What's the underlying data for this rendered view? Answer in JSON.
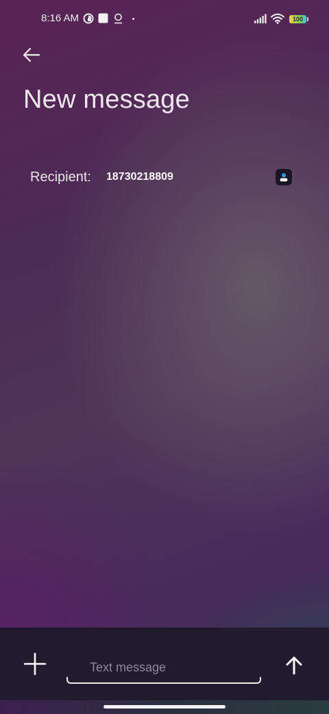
{
  "status_bar": {
    "time": "8:16 AM",
    "battery": "100",
    "icons": [
      "data-saver-icon",
      "notification-square-icon",
      "location-pin-icon",
      "signal-icon",
      "wifi-icon",
      "battery-icon"
    ]
  },
  "header": {
    "back_icon": "arrow-left-icon",
    "title": "New message"
  },
  "recipient": {
    "label": "Recipient:",
    "value": "18730218809",
    "contacts_icon": "contact-person-icon"
  },
  "compose": {
    "add_icon": "plus-icon",
    "placeholder": "Text message",
    "value": "",
    "send_icon": "arrow-up-icon"
  },
  "colors": {
    "compose_bar": "#221b2e",
    "contact_icon_accent": "#2a9df4"
  }
}
